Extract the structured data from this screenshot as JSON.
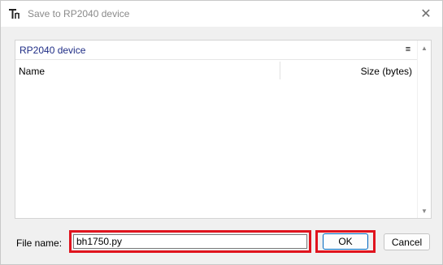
{
  "window": {
    "title": "Save to RP2040 device",
    "close_glyph": "✕",
    "app_icon": "thonny-icon"
  },
  "browser": {
    "location": "RP2040 device",
    "menu_glyph": "≡",
    "columns": {
      "name": "Name",
      "size": "Size (bytes)"
    },
    "files": []
  },
  "form": {
    "filename_label": "File name:",
    "filename_value": "bh1750.py",
    "ok_label": "OK",
    "cancel_label": "Cancel"
  },
  "colors": {
    "highlight": "#e0141e",
    "location_text": "#1f2d86",
    "default_button_border": "#0067c0"
  }
}
